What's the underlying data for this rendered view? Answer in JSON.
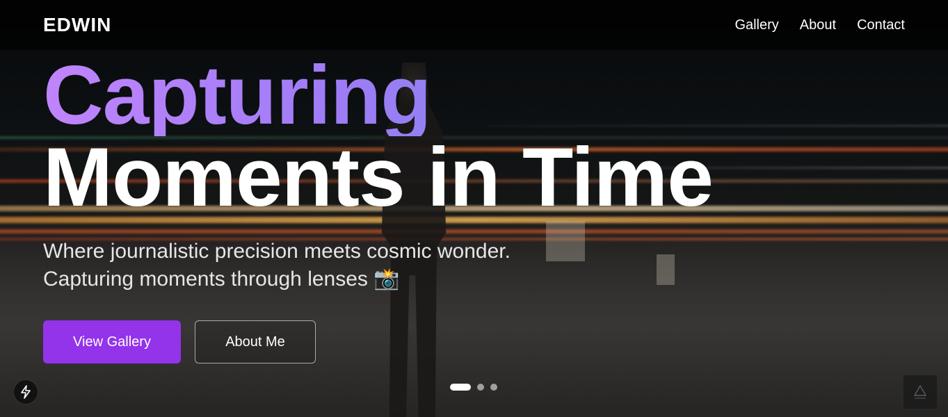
{
  "nav": {
    "logo": "EDWIN",
    "links": [
      {
        "label": "Gallery"
      },
      {
        "label": "About"
      },
      {
        "label": "Contact"
      }
    ]
  },
  "hero": {
    "headline_line1": "Capturing",
    "headline_line2": "Moments in Time",
    "subtitle_line1": "Where journalistic precision meets cosmic wonder.",
    "subtitle_line2": "Capturing moments through lenses 📸",
    "primary_button": "View Gallery",
    "secondary_button": "About Me"
  },
  "carousel": {
    "slide_count": 3,
    "active_index": 0
  },
  "icons": {
    "quick_action": "bolt-icon",
    "corner_badge": "logo-badge-icon"
  },
  "colors": {
    "accent": "#9333ea",
    "gradient_start": "#c084fc",
    "gradient_end": "#7c8cf0"
  }
}
